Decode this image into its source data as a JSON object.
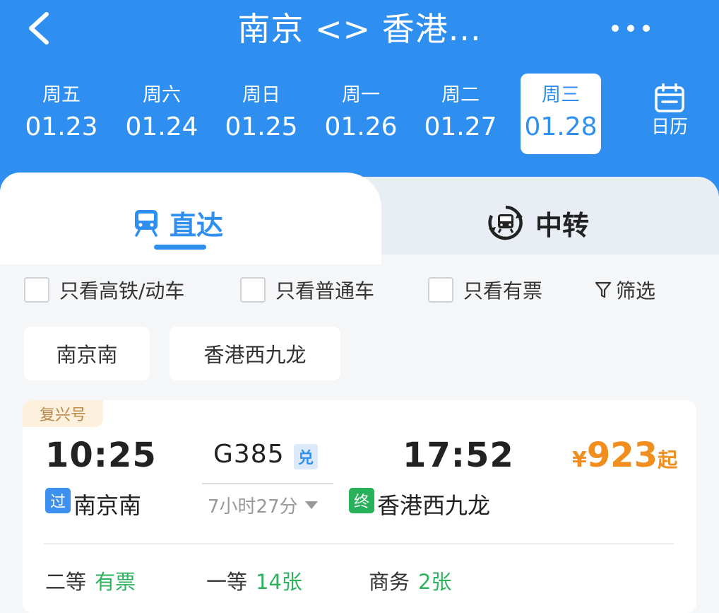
{
  "header": {
    "title": "南京 <> 香港...",
    "back_icon": "chevron-left-icon",
    "more_icon": "more-icon"
  },
  "dates": [
    {
      "weekday": "周五",
      "date": "01.23",
      "selected": false
    },
    {
      "weekday": "周六",
      "date": "01.24",
      "selected": false
    },
    {
      "weekday": "周日",
      "date": "01.25",
      "selected": false
    },
    {
      "weekday": "周一",
      "date": "01.26",
      "selected": false
    },
    {
      "weekday": "周二",
      "date": "01.27",
      "selected": false
    },
    {
      "weekday": "周三",
      "date": "01.28",
      "selected": true
    }
  ],
  "calendar": {
    "label": "日历",
    "icon": "calendar-icon"
  },
  "tabs": {
    "direct": {
      "label": "直达",
      "icon": "train-icon",
      "active": true
    },
    "transfer": {
      "label": "中转",
      "icon": "transfer-icon",
      "active": false
    }
  },
  "filters": [
    {
      "label": "只看高铁/动车",
      "checked": false
    },
    {
      "label": "只看普通车",
      "checked": false
    },
    {
      "label": "只看有票",
      "checked": false
    }
  ],
  "screen": {
    "label": "筛选",
    "icon": "filter-icon"
  },
  "stations": [
    "南京南",
    "香港西九龙"
  ],
  "train": {
    "badge": "复兴号",
    "dep_time": "10:25",
    "arr_time": "17:52",
    "number": "G385",
    "exchange_tag": "兑",
    "duration": "7小时27分",
    "dep_tag": "过",
    "dep_station": "南京南",
    "arr_tag": "终",
    "arr_station": "香港西九龙",
    "price_currency": "¥",
    "price": "923",
    "price_suffix": "起",
    "seats": [
      {
        "name": "二等",
        "value": "有票"
      },
      {
        "name": "一等",
        "value": "14张"
      },
      {
        "name": "商务",
        "value": "2张"
      }
    ]
  },
  "colors": {
    "primary": "#2f8ff0",
    "price": "#f18e20",
    "available": "#2eb25e",
    "badge_bg": "#fdf1dd"
  }
}
